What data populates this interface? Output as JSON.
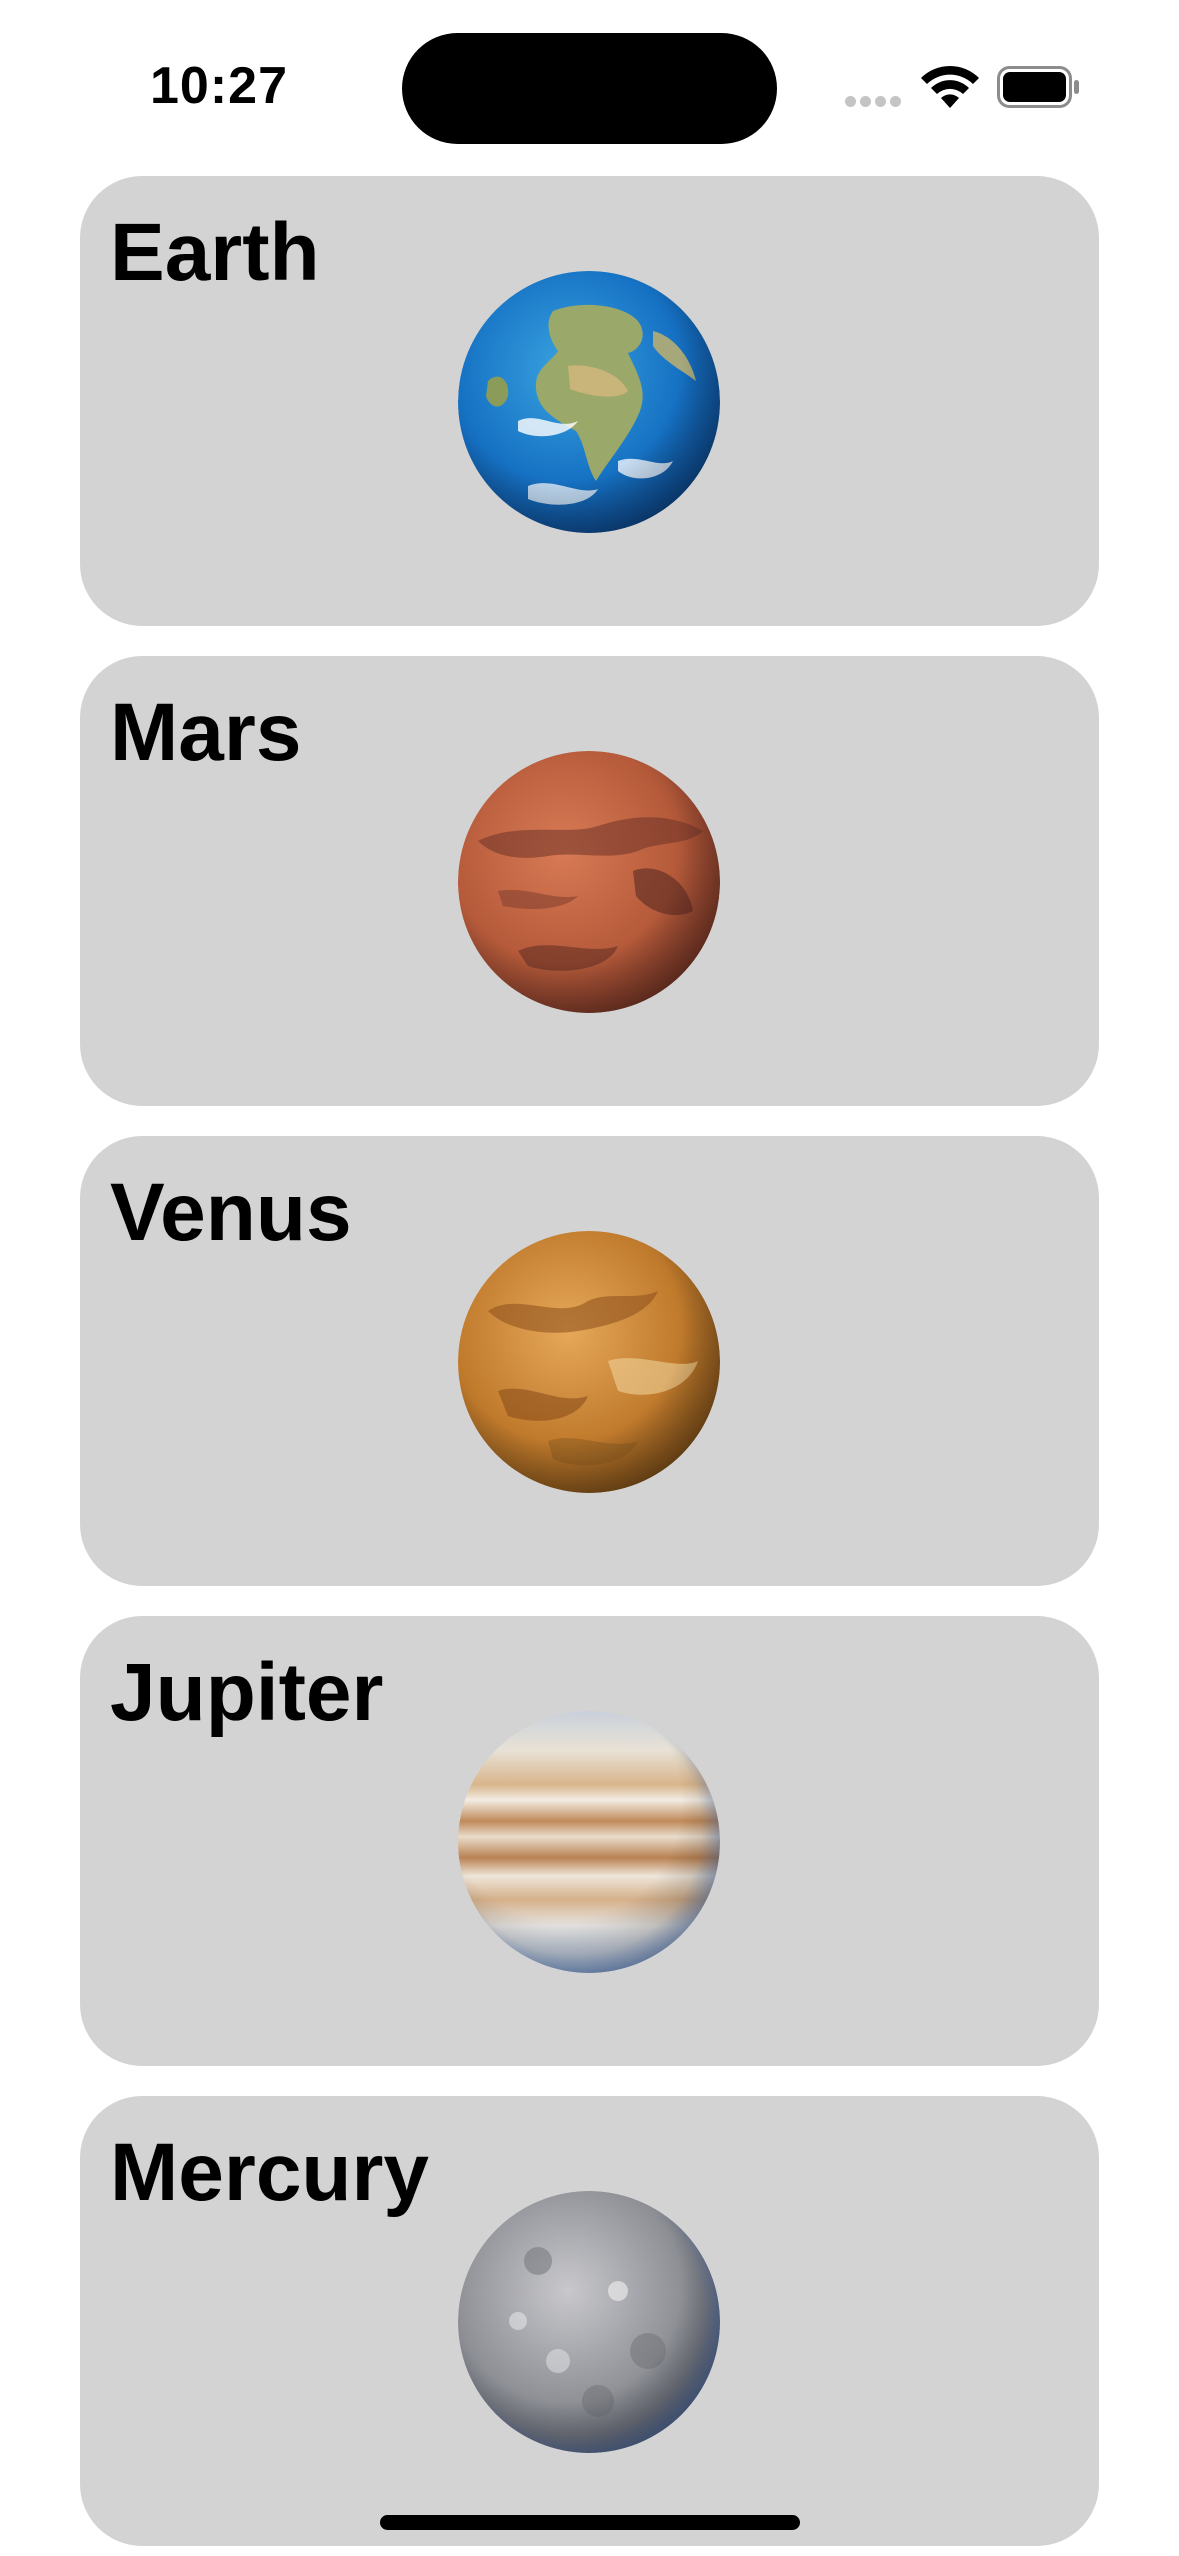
{
  "status_bar": {
    "time": "10:27",
    "icons": [
      "cellular-signal-icon",
      "wifi-icon",
      "battery-icon"
    ]
  },
  "planets": [
    {
      "name": "Earth",
      "icon": "earth-globe-icon"
    },
    {
      "name": "Mars",
      "icon": "mars-globe-icon"
    },
    {
      "name": "Venus",
      "icon": "venus-globe-icon"
    },
    {
      "name": "Jupiter",
      "icon": "jupiter-globe-icon"
    },
    {
      "name": "Mercury",
      "icon": "mercury-globe-icon"
    }
  ],
  "colors": {
    "card_background": "#d3d3d3",
    "page_background": "#ffffff",
    "text": "#000000"
  }
}
